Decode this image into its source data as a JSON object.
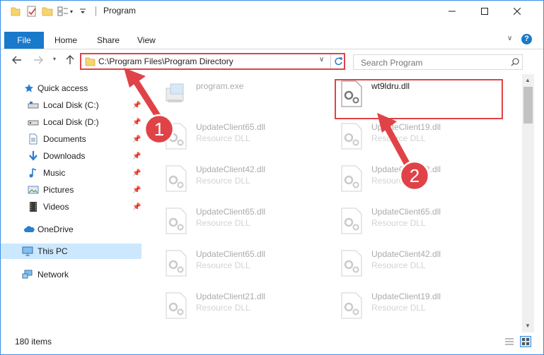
{
  "title": "Program",
  "ribbon": {
    "file": "File",
    "home": "Home",
    "share": "Share",
    "view": "View"
  },
  "address": {
    "path": "C:\\Program Files\\Program Directory"
  },
  "search": {
    "placeholder": "Search Program"
  },
  "sidebar": {
    "quick_access": "Quick access",
    "items": [
      {
        "label": "Local Disk (C:)",
        "icon": "drive-icon",
        "pinned": true
      },
      {
        "label": "Local Disk (D:)",
        "icon": "drive-icon",
        "pinned": true
      },
      {
        "label": "Documents",
        "icon": "documents-icon",
        "pinned": true
      },
      {
        "label": "Downloads",
        "icon": "downloads-icon",
        "pinned": true
      },
      {
        "label": "Music",
        "icon": "music-icon",
        "pinned": true
      },
      {
        "label": "Pictures",
        "icon": "pictures-icon",
        "pinned": true
      },
      {
        "label": "Videos",
        "icon": "videos-icon",
        "pinned": true
      }
    ],
    "onedrive": "OneDrive",
    "thispc": "This PC",
    "network": "Network"
  },
  "files": {
    "highlighted": {
      "name": "program.exe"
    },
    "dll": {
      "name": "wt9ldru.dll"
    },
    "list": [
      {
        "name": "UpdateClient65.dll",
        "type": "Resource DLL"
      },
      {
        "name": "UpdateClient19.dll",
        "type": "Resource DLL"
      },
      {
        "name": "UpdateClient42.dll",
        "type": "Resource DLL"
      },
      {
        "name": "UpdateClient42.dll",
        "type": "Resource DLL"
      },
      {
        "name": "UpdateClient65.dll",
        "type": "Resource DLL"
      },
      {
        "name": "UpdateClient65.dll",
        "type": "Resource DLL"
      },
      {
        "name": "UpdateClient65.dll",
        "type": "Resource DLL"
      },
      {
        "name": "UpdateClient42.dll",
        "type": "Resource DLL"
      },
      {
        "name": "UpdateClient21.dll",
        "type": "Resource DLL"
      },
      {
        "name": "UpdateClient19.dll",
        "type": "Resource DLL"
      }
    ]
  },
  "annotations": {
    "step1": "1",
    "step2": "2"
  },
  "status": {
    "items": "180 items"
  },
  "colors": {
    "accent": "#1979ca",
    "highlight": "#e04347",
    "selected": "#cce8ff"
  }
}
